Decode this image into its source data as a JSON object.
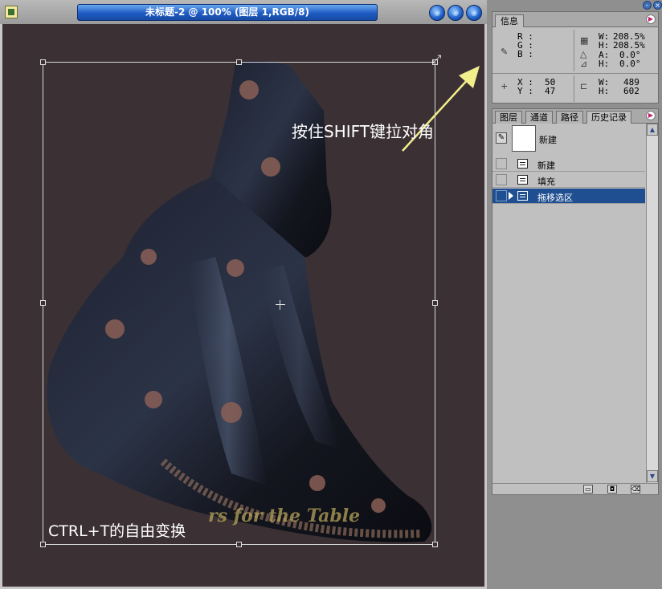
{
  "document": {
    "title": "未标题-2 @ 100% (图层 1,RGB/8)"
  },
  "canvas": {
    "watermark_text": "rs for the Table",
    "annotation_shift": "按住SHIFT键拉对角",
    "annotation_ctrl": "CTRL+T的自由变换"
  },
  "info_palette": {
    "tab": "信息",
    "r_label": "R :",
    "g_label": "G :",
    "b_label": "B :",
    "w_pct_label": "W:",
    "w_pct_value": "208.5%",
    "h_pct_label": "H:",
    "h_pct_value": "208.5%",
    "a_label": "A:",
    "a_value": "0.0°",
    "skew_h_label": "H:",
    "skew_h_value": "0.0°",
    "x_label": "X :",
    "x_value": "50",
    "y_label": "Y :",
    "y_value": "47",
    "size_w_label": "W:",
    "size_w_value": "489",
    "size_h_label": "H:",
    "size_h_value": "602"
  },
  "history_palette": {
    "tabs": [
      "图层",
      "通道",
      "路径",
      "历史记录"
    ],
    "active_tab": "历史记录",
    "snapshot_label": "新建",
    "items": [
      {
        "label": "新建"
      },
      {
        "label": "填充"
      },
      {
        "label": "拖移选区"
      }
    ],
    "active_item_index": 2
  },
  "icons": {
    "eyedropper": "eyedropper-icon",
    "crosshair": "crosshair-icon",
    "resize": "resize-diagonal-icon",
    "history_brush": "history-brush-icon",
    "new_document_from_state": "new-document-icon",
    "new_snapshot": "camera-icon",
    "trash": "trash-icon"
  },
  "colors": {
    "canvas_bg": "#3b3134",
    "title_bar": "#1f5bc3",
    "history_selected": "#1f4f90",
    "annotation_arrow": "#f2ee8c"
  }
}
